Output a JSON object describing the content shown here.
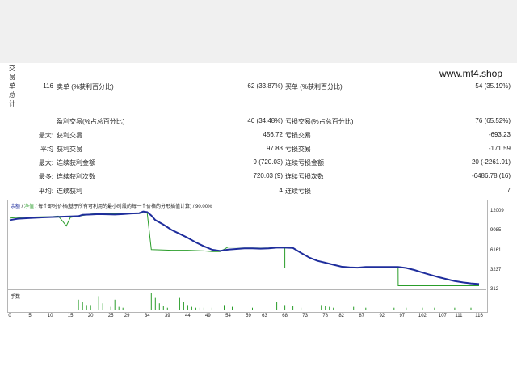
{
  "watermark": "www.mt4.shop",
  "section_title_chars": [
    "交",
    "易",
    "单",
    "总",
    "计"
  ],
  "stats": {
    "total": "116",
    "sell_label": "卖单 (%获利百分比)",
    "sell_value": "62 (33.87%)",
    "buy_label": "买单 (%获利百分比)",
    "buy_value": "54 (35.19%)",
    "profit_trades_label": "盈利交易(%占总百分比)",
    "profit_trades_value": "40 (34.48%)",
    "loss_trades_label": "亏损交易(%占总百分比)",
    "loss_trades_value": "76 (65.52%)",
    "rows": [
      {
        "prefix": "最大:",
        "label1": "获利交易",
        "value1": "456.72",
        "label2": "亏损交易",
        "value2": "-693.23"
      },
      {
        "prefix": "平均",
        "label1": "获利交易",
        "value1": "97.83",
        "label2": "亏损交易",
        "value2": "-171.59"
      },
      {
        "prefix": "最大:",
        "label1": "连续获利金额",
        "value1": "9 (720.03)",
        "label2": "连续亏损金额",
        "value2": "20 (-2261.91)"
      },
      {
        "prefix": "最多:",
        "label1": "连续获利次数",
        "value1": "720.03 (9)",
        "label2": "连续亏损次数",
        "value2": "-6486.78 (16)"
      },
      {
        "prefix": "平均:",
        "label1": "连续获利",
        "value1": "4",
        "label2": "连续亏损",
        "value2": "7"
      }
    ]
  },
  "chart_data": {
    "type": "line",
    "legend": {
      "series1": "余额",
      "sep1": " / ",
      "series2": "净值",
      "sep2": " / ",
      "rest": "每个即时价格(基于所有可利用的最小时段的每一个价格的分形插值计算) / 90.00%"
    },
    "y_ticks": [
      "12009",
      "9085",
      "6161",
      "3237",
      "312"
    ],
    "ylim": [
      312,
      12009
    ],
    "x_ticks": [
      "0",
      "5",
      "10",
      "15",
      "20",
      "25",
      "29",
      "34",
      "39",
      "44",
      "49",
      "54",
      "59",
      "63",
      "68",
      "73",
      "78",
      "82",
      "87",
      "92",
      "97",
      "102",
      "107",
      "111",
      "116"
    ],
    "x_tick_values": [
      0,
      5,
      10,
      15,
      20,
      25,
      29,
      34,
      39,
      44,
      49,
      54,
      59,
      63,
      68,
      73,
      78,
      82,
      87,
      92,
      97,
      102,
      107,
      111,
      116
    ],
    "xlim": [
      0,
      117
    ],
    "series": [
      {
        "color": "#1e2d9c",
        "x": [
          0,
          2,
          5,
          8,
          10,
          12,
          15,
          17,
          18,
          20,
          22,
          24,
          26,
          28,
          30,
          32,
          33,
          34,
          35,
          36,
          38,
          40,
          42,
          44,
          46,
          48,
          50,
          52,
          54,
          56,
          58,
          60,
          62,
          64,
          66,
          68,
          70,
          72,
          74,
          76,
          78,
          80,
          82,
          84,
          86,
          88,
          90,
          92,
          94,
          96,
          98,
          100,
          102,
          104,
          106,
          108,
          110,
          112,
          114,
          116
        ],
        "y": [
          10500,
          10700,
          10800,
          10900,
          10950,
          11000,
          11050,
          11100,
          11300,
          11350,
          11400,
          11380,
          11350,
          11400,
          11500,
          11550,
          11800,
          11700,
          11200,
          10500,
          9800,
          9000,
          8400,
          7800,
          7100,
          6500,
          6000,
          5800,
          6000,
          6100,
          6200,
          6200,
          6150,
          6200,
          6300,
          6300,
          6250,
          5500,
          4800,
          4300,
          4000,
          3700,
          3400,
          3300,
          3250,
          3350,
          3350,
          3350,
          3350,
          3350,
          3200,
          2900,
          2500,
          2150,
          1800,
          1500,
          1200,
          1000,
          850,
          750
        ]
      },
      {
        "color": "#2a9d2a",
        "x": [
          0,
          2,
          5,
          8,
          10,
          12,
          13,
          14,
          15,
          17,
          18,
          20,
          22,
          26,
          28,
          30,
          32,
          34,
          34.01,
          35,
          40,
          44,
          48,
          50,
          52,
          54,
          56,
          58,
          60,
          62,
          64,
          66,
          68,
          68.01,
          70,
          76,
          82,
          88,
          94,
          96,
          96.01,
          100,
          106,
          110,
          116
        ],
        "y": [
          10800,
          10900,
          10950,
          11000,
          11000,
          11100,
          10400,
          9600,
          10900,
          11100,
          11200,
          11400,
          11500,
          11500,
          11500,
          11500,
          11500,
          11700,
          11500,
          6000,
          5900,
          5900,
          5800,
          5700,
          5700,
          6400,
          6400,
          6400,
          6400,
          6400,
          6400,
          6400,
          6400,
          3200,
          3200,
          3200,
          3200,
          3200,
          3200,
          3200,
          500,
          500,
          500,
          500,
          500
        ]
      }
    ],
    "volume_label": "手数",
    "volumes": [
      {
        "x": 17,
        "v": 0.6
      },
      {
        "x": 18,
        "v": 0.5
      },
      {
        "x": 19,
        "v": 0.3
      },
      {
        "x": 20,
        "v": 0.3
      },
      {
        "x": 22,
        "v": 0.8
      },
      {
        "x": 23,
        "v": 0.4
      },
      {
        "x": 25,
        "v": 0.2
      },
      {
        "x": 26,
        "v": 0.6
      },
      {
        "x": 27,
        "v": 0.2
      },
      {
        "x": 28,
        "v": 0.15
      },
      {
        "x": 35,
        "v": 1.0
      },
      {
        "x": 36,
        "v": 0.7
      },
      {
        "x": 37,
        "v": 0.4
      },
      {
        "x": 38,
        "v": 0.25
      },
      {
        "x": 39,
        "v": 0.15
      },
      {
        "x": 42,
        "v": 0.7
      },
      {
        "x": 43,
        "v": 0.5
      },
      {
        "x": 44,
        "v": 0.3
      },
      {
        "x": 45,
        "v": 0.2
      },
      {
        "x": 46,
        "v": 0.15
      },
      {
        "x": 47,
        "v": 0.15
      },
      {
        "x": 48,
        "v": 0.15
      },
      {
        "x": 50,
        "v": 0.15
      },
      {
        "x": 53,
        "v": 0.3
      },
      {
        "x": 55,
        "v": 0.2
      },
      {
        "x": 60,
        "v": 0.15
      },
      {
        "x": 66,
        "v": 0.5
      },
      {
        "x": 68,
        "v": 0.3
      },
      {
        "x": 70,
        "v": 0.25
      },
      {
        "x": 72,
        "v": 0.15
      },
      {
        "x": 77,
        "v": 0.3
      },
      {
        "x": 78,
        "v": 0.25
      },
      {
        "x": 79,
        "v": 0.2
      },
      {
        "x": 80,
        "v": 0.15
      },
      {
        "x": 85,
        "v": 0.2
      },
      {
        "x": 88,
        "v": 0.15
      },
      {
        "x": 95,
        "v": 0.15
      },
      {
        "x": 98,
        "v": 0.15
      },
      {
        "x": 102,
        "v": 0.15
      },
      {
        "x": 105,
        "v": 0.15
      },
      {
        "x": 110,
        "v": 0.15
      },
      {
        "x": 114,
        "v": 0.15
      }
    ]
  }
}
